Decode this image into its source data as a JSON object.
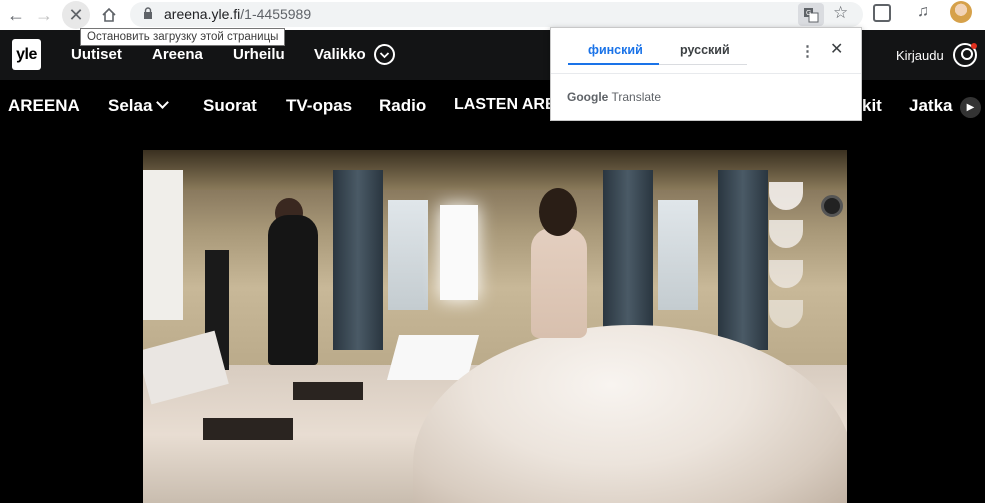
{
  "browser": {
    "url_host": "areena.yle.fi",
    "url_path": "/1-4455989",
    "tooltip": "Остановить загрузку этой страницы"
  },
  "yle_header": {
    "logo": "yle",
    "links": [
      "Uutiset",
      "Areena",
      "Urheilu",
      "Valikko"
    ],
    "login": "Kirjaudu"
  },
  "areena_nav": {
    "brand": "AREENA",
    "items": [
      "Selaa",
      "Suorat",
      "TV-opas",
      "Radio",
      "LASTEN AREENA",
      "kit",
      "Jatka"
    ]
  },
  "translate_popup": {
    "source_lang": "финский",
    "target_lang": "русский",
    "brand_google": "Google",
    "brand_translate": "Translate"
  },
  "colors": {
    "yle_bar": "#131415",
    "accent_blue": "#1a73e8",
    "notification_dot": "#e0301e"
  }
}
